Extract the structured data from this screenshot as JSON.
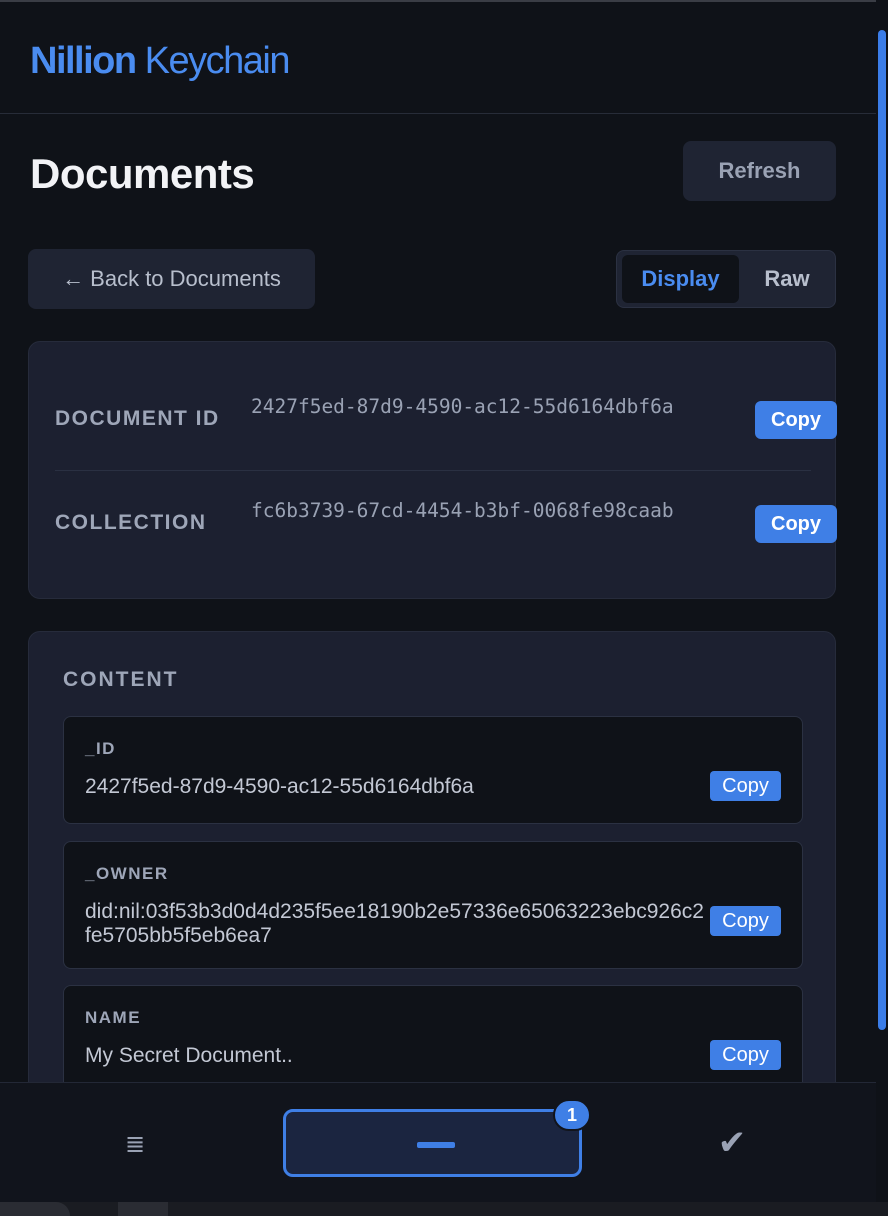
{
  "app": {
    "brand": "Nillion",
    "product": "Keychain"
  },
  "page": {
    "title": "Documents",
    "refresh_label": "Refresh",
    "back_label": "← Back to Documents"
  },
  "view_toggle": {
    "options": [
      "Display",
      "Raw"
    ],
    "selected": "Display"
  },
  "metadata": {
    "rows": [
      {
        "label": "DOCUMENT ID",
        "value": "2427f5ed-87d9-4590-ac12-55d6164dbf6a",
        "copy_label": "Copy"
      },
      {
        "label": "COLLECTION",
        "value": "fc6b3739-67cd-4454-b3bf-0068fe98caab",
        "copy_label": "Copy"
      }
    ]
  },
  "content": {
    "heading": "CONTENT",
    "fields": [
      {
        "label": "_ID",
        "value": "2427f5ed-87d9-4590-ac12-55d6164dbf6a",
        "copy_label": "Copy"
      },
      {
        "label": "_OWNER",
        "value": "did:nil:03f53b3d0d4d235f5ee18190b2e57336e65063223ebc926c2fe5705bb5f5eb6ea7",
        "copy_label": "Copy"
      },
      {
        "label": "NAME",
        "value": "My Secret Document..",
        "copy_label": "Copy"
      }
    ]
  },
  "bottom_nav": {
    "list_icon": "list-icon",
    "center_icon": "minus-icon",
    "badge_count": "1",
    "check_icon": "check-icon"
  },
  "colors": {
    "accent": "#3f7fe6",
    "background": "#0f1218",
    "card": "#1c2030"
  }
}
